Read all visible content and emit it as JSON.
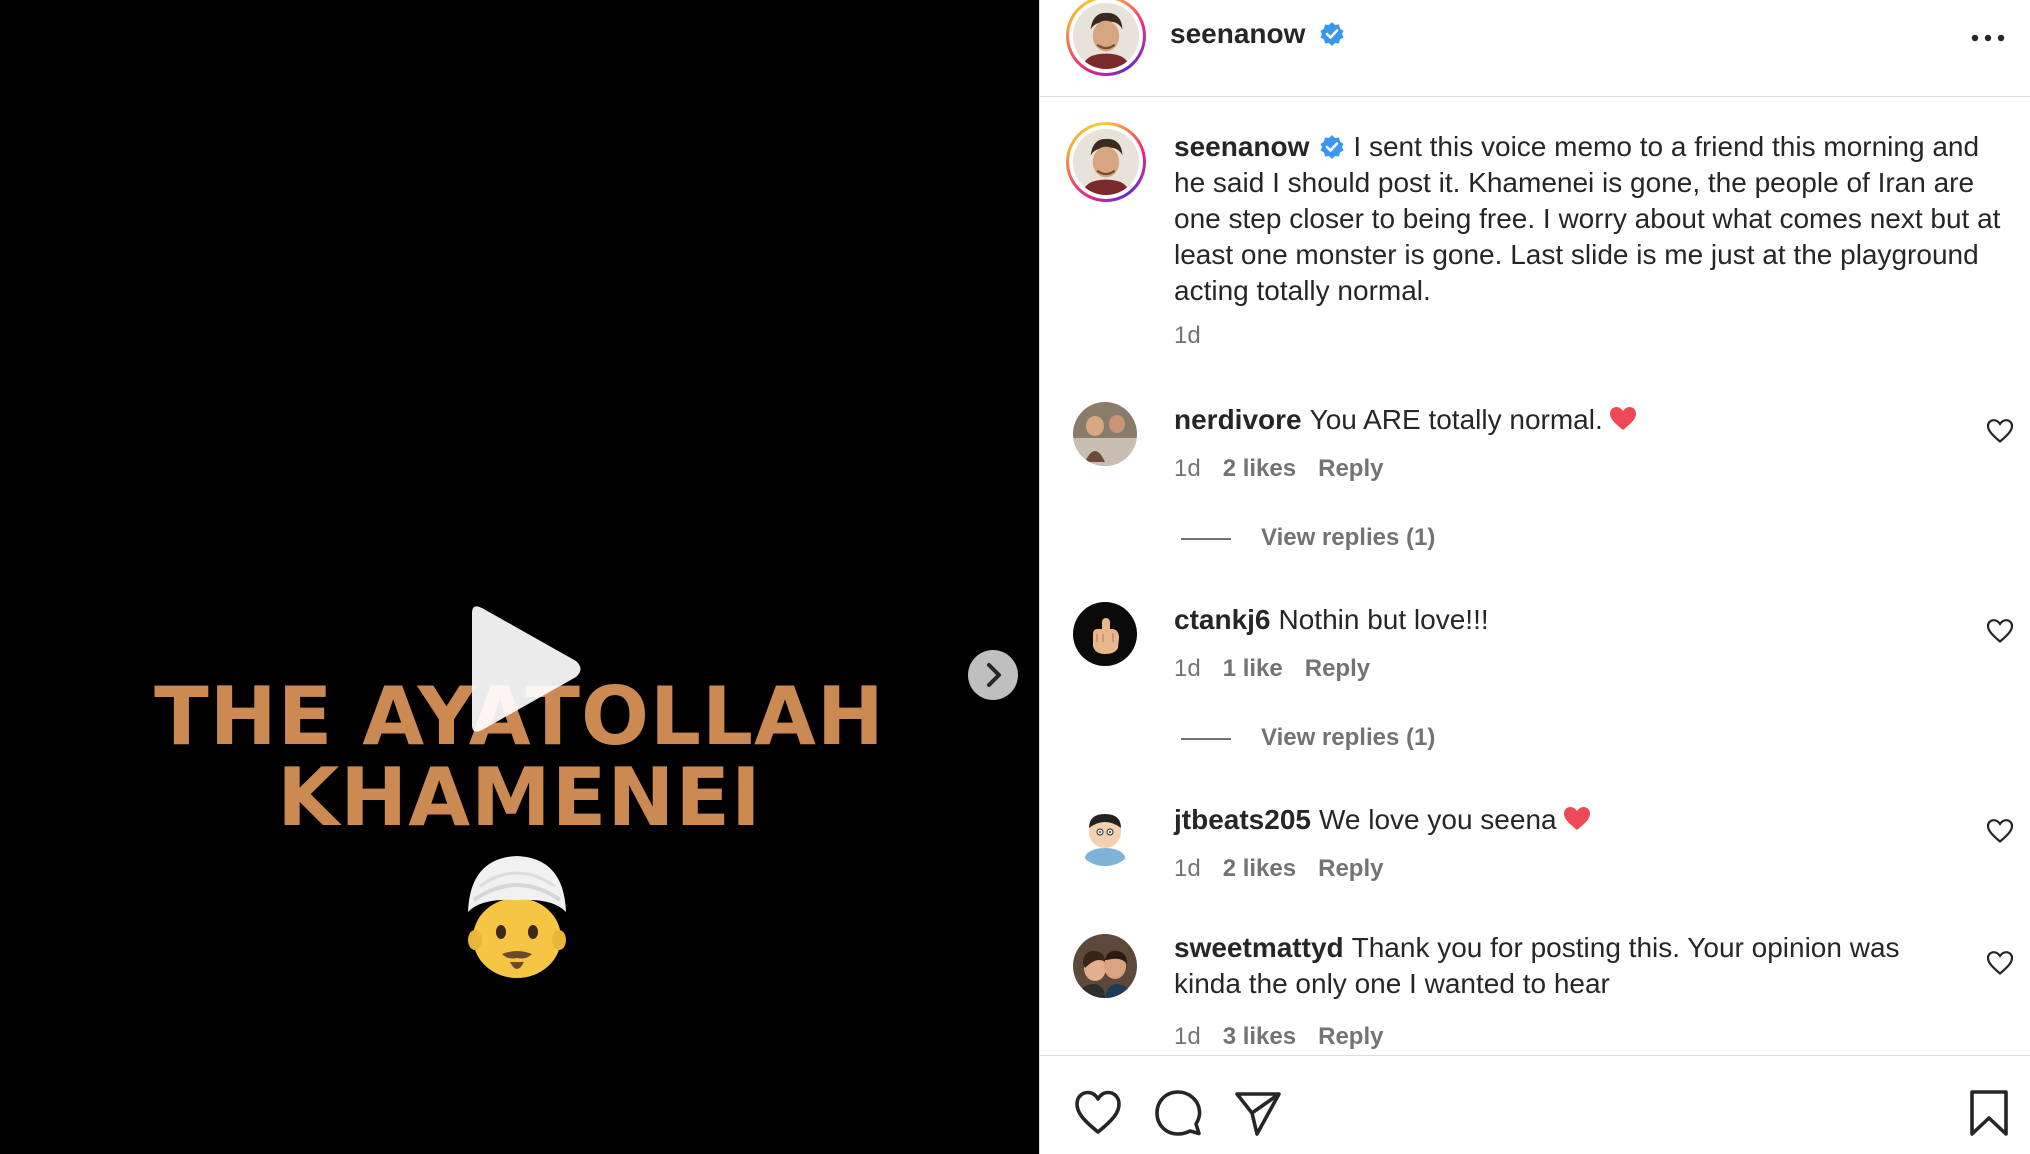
{
  "media": {
    "overlay_line1": "THE AYATOLLAH",
    "overlay_line2": "KHAMENEI",
    "text_color": "#cc8a52",
    "emoji": "man-with-turban-emoji"
  },
  "post": {
    "author": "seenanow",
    "verified": true,
    "caption": "I sent this voice memo to a friend this morning and he said I should post it. Khamenei is gone, the people of Iran are one step closer to being free. I worry about what comes next but at least one monster is gone. Last slide is me just at the playground acting totally normal.",
    "time": "1d"
  },
  "comments": [
    {
      "user": "nerdivore",
      "text": "You ARE totally normal.",
      "heart": true,
      "time": "1d",
      "likes": "2 likes",
      "reply": "Reply",
      "view_replies": "View replies (1)"
    },
    {
      "user": "ctankj6",
      "text": "Nothin but love!!!",
      "heart": false,
      "time": "1d",
      "likes": "1 like",
      "reply": "Reply",
      "view_replies": "View replies (1)"
    },
    {
      "user": "jtbeats205",
      "text": "We love you seena",
      "heart": true,
      "time": "1d",
      "likes": "2 likes",
      "reply": "Reply"
    },
    {
      "user": "sweetmattyd",
      "text": "Thank you for posting this. Your opinion was kinda the only one I wanted to hear",
      "heart": false,
      "time": "1d",
      "likes": "3 likes",
      "reply": "Reply"
    }
  ],
  "colors": {
    "verified": "#3897f0",
    "heart": "#ed4956",
    "muted": "#737373",
    "border": "#dbdbdb"
  }
}
